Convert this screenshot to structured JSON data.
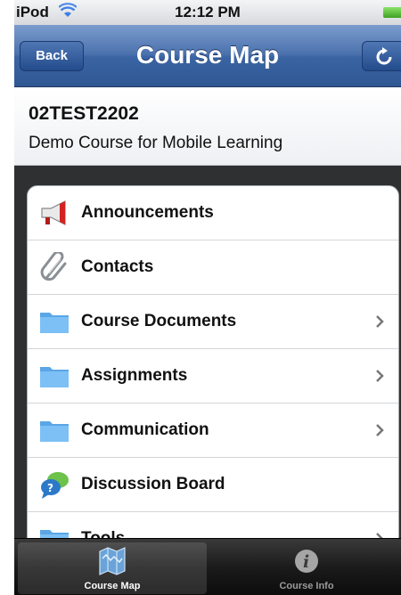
{
  "status_bar": {
    "carrier": "iPod",
    "time": "12:12 PM"
  },
  "nav": {
    "back_label": "Back",
    "title": "Course Map",
    "refresh_icon": "refresh-icon"
  },
  "course": {
    "code": "02TEST2202",
    "name": "Demo Course for Mobile Learning"
  },
  "menu": {
    "items": [
      {
        "label": "Announcements",
        "icon": "megaphone-icon",
        "has_chevron": false
      },
      {
        "label": "Contacts",
        "icon": "paperclip-icon",
        "has_chevron": false
      },
      {
        "label": "Course Documents",
        "icon": "folder-icon",
        "has_chevron": true
      },
      {
        "label": "Assignments",
        "icon": "folder-icon",
        "has_chevron": true
      },
      {
        "label": "Communication",
        "icon": "folder-icon",
        "has_chevron": true
      },
      {
        "label": "Discussion Board",
        "icon": "discussion-icon",
        "has_chevron": false
      },
      {
        "label": "Tools",
        "icon": "folder-icon",
        "has_chevron": true
      }
    ]
  },
  "tabs": [
    {
      "label": "Course Map",
      "icon": "map-icon",
      "active": true
    },
    {
      "label": "Course Info",
      "icon": "info-icon",
      "active": false
    }
  ],
  "colors": {
    "nav_bar": "#3a64a3",
    "battery": "#4fc12d",
    "background": "#2f3032"
  }
}
